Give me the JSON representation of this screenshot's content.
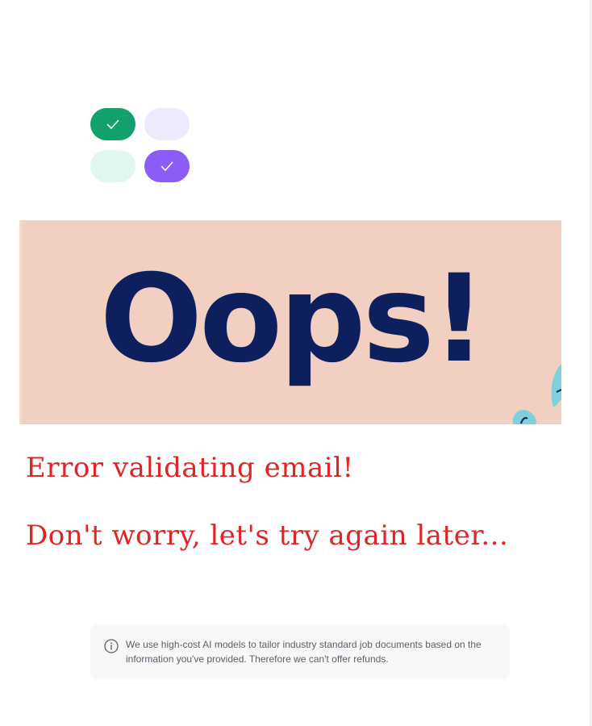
{
  "toggles": [
    {
      "state": "checked",
      "color": "#12a16d",
      "icon": "check-icon"
    },
    {
      "state": "unchecked",
      "color": "#ecebfd"
    },
    {
      "state": "unchecked",
      "color": "#e0f6ee"
    },
    {
      "state": "checked",
      "color": "#8b5cf6",
      "icon": "check-icon"
    }
  ],
  "banner": {
    "text": "Oops!",
    "background_color": "#f1d0c1",
    "text_color": "#0d1f5c"
  },
  "messages": {
    "error": "Error validating email!",
    "retry": "Don't worry, let's try again later..."
  },
  "notice": {
    "icon": "info-icon",
    "text": "We use high-cost AI models to tailor industry standard job documents based on the information you've provided. Therefore we can't offer refunds."
  },
  "colors": {
    "error_text": "#e02424",
    "green": "#12a16d",
    "purple": "#8b5cf6"
  }
}
